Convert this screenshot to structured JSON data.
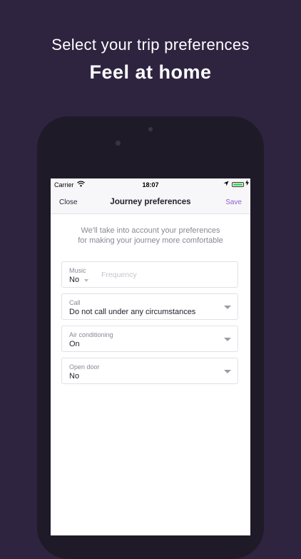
{
  "promo": {
    "headline": "Select your trip preferences",
    "subhead": "Feel at home"
  },
  "status_bar": {
    "carrier": "Carrier",
    "time": "18:07"
  },
  "navbar": {
    "close_label": "Close",
    "title": "Journey preferences",
    "save_label": "Save"
  },
  "intro": {
    "line1": "We'll take into account your preferences",
    "line2": "for making your journey more comfortable"
  },
  "preferences": {
    "music": {
      "label": "Music",
      "value": "No",
      "frequency_placeholder": "Frequency"
    },
    "call": {
      "label": "Call",
      "value": "Do not call under any circumstances"
    },
    "air_conditioning": {
      "label": "Air conditioning",
      "value": "On"
    },
    "open_door": {
      "label": "Open door",
      "value": "No"
    }
  },
  "colors": {
    "background": "#2e2440",
    "accent": "#8a5fd0",
    "battery": "#4cd964"
  }
}
